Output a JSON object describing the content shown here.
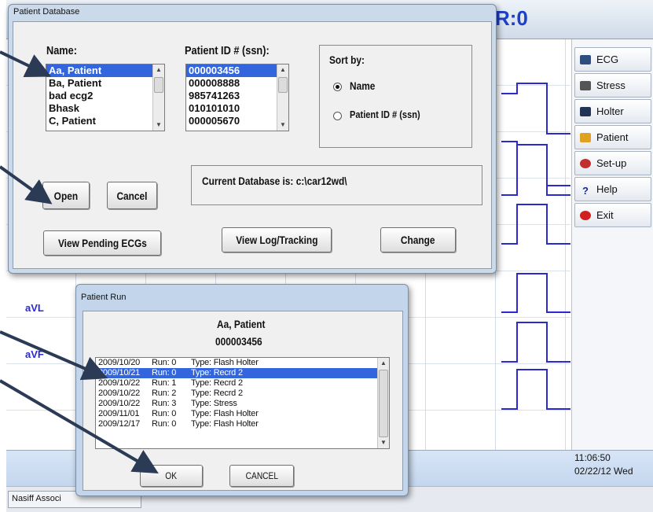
{
  "app": {
    "hr_readout": "R:0",
    "leads": [
      "aVL",
      "aVF"
    ],
    "side_buttons": [
      {
        "label": "ECG",
        "icon": "ecg-icon",
        "color": "#2d4f80"
      },
      {
        "label": "Stress",
        "icon": "stress-icon",
        "color": "#555555"
      },
      {
        "label": "Holter",
        "icon": "holter-icon",
        "color": "#223355"
      },
      {
        "label": "Patient",
        "icon": "patient-folder-icon",
        "color": "#e0a020"
      },
      {
        "label": "Set-up",
        "icon": "setup-icon",
        "color": "#c03030"
      },
      {
        "label": "Help",
        "icon": "help-icon",
        "color": "#1a2a8a"
      },
      {
        "label": "Exit",
        "icon": "exit-icon",
        "color": "#d02020"
      }
    ],
    "clock_time": "11:06:50",
    "clock_date": "02/22/12 Wed",
    "taskbar_item": "Nasiff Associ"
  },
  "patient_db": {
    "title": "Patient Database",
    "name_label": "Name:",
    "id_label": "Patient ID # (ssn):",
    "names": [
      "Aa, Patient",
      "Ba, Patient",
      "bad ecg2",
      "Bhask",
      "C, Patient"
    ],
    "ids": [
      "000003456",
      "000008888",
      "985741263",
      "010101010",
      "000005670"
    ],
    "selected_index": 0,
    "sort_label": "Sort by:",
    "sort_name": "Name",
    "sort_id": "Patient ID # (ssn)",
    "sort_selected": "Name",
    "current_db": "Current Database is: c:\\car12wd\\",
    "open": "Open",
    "cancel": "Cancel",
    "view_pending": "View Pending ECGs",
    "view_log": "View Log/Tracking",
    "change": "Change"
  },
  "patient_run": {
    "title": "Patient Run",
    "patient_name": "Aa, Patient",
    "patient_id": "000003456",
    "runs": [
      {
        "date": "2009/10/20",
        "run": "Run: 0",
        "type": "Type: Flash Holter"
      },
      {
        "date": "2009/10/21",
        "run": "Run: 0",
        "type": "Type: Recrd 2"
      },
      {
        "date": "2009/10/22",
        "run": "Run: 1",
        "type": "Type: Recrd 2"
      },
      {
        "date": "2009/10/22",
        "run": "Run: 2",
        "type": "Type: Recrd 2"
      },
      {
        "date": "2009/10/22",
        "run": "Run: 3",
        "type": "Type: Stress"
      },
      {
        "date": "2009/11/01",
        "run": "Run: 0",
        "type": "Type: Flash Holter"
      },
      {
        "date": "2009/12/17",
        "run": "Run: 0",
        "type": "Type: Flash Holter"
      }
    ],
    "selected_index": 1,
    "ok": "OK",
    "cancel": "CANCEL"
  },
  "colors": {
    "selection": "#3366dd",
    "ecg_trace": "#2a2ad0",
    "annotation_arrow": "#2b3a55"
  }
}
